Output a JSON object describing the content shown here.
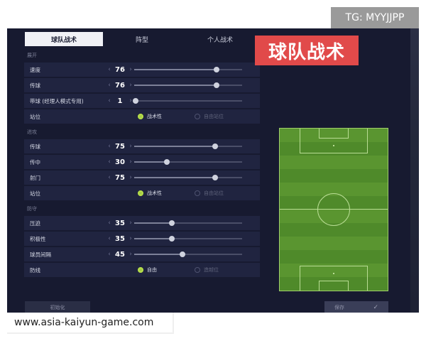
{
  "watermark": {
    "tg": "TG: MYYJJPP",
    "url": "www.asia-kaiyun-game.com"
  },
  "banner": "球队战术",
  "tabs": [
    {
      "label": "球队战术",
      "active": true
    },
    {
      "label": "阵型",
      "active": false
    },
    {
      "label": "个人战术",
      "active": false
    }
  ],
  "sections": {
    "build": {
      "title": "展开",
      "rows": [
        {
          "label": "速度",
          "value": "76",
          "level": 0.76
        },
        {
          "label": "传球",
          "value": "76",
          "level": 0.76
        },
        {
          "label": "带球 (经理人模式专用)",
          "value": "1",
          "level": 0.01
        }
      ],
      "position": {
        "label": "站位",
        "opt_on": "战术性",
        "opt_off": "自由站位"
      }
    },
    "attack": {
      "title": "进攻",
      "rows": [
        {
          "label": "传球",
          "value": "75",
          "level": 0.75
        },
        {
          "label": "传中",
          "value": "30",
          "level": 0.3
        },
        {
          "label": "射门",
          "value": "75",
          "level": 0.75
        }
      ],
      "position": {
        "label": "站位",
        "opt_on": "战术性",
        "opt_off": "自由站位"
      }
    },
    "defence": {
      "title": "防守",
      "rows": [
        {
          "label": "压迫",
          "value": "35",
          "level": 0.35
        },
        {
          "label": "积极性",
          "value": "35",
          "level": 0.35
        },
        {
          "label": "球员间隔",
          "value": "45",
          "level": 0.45
        }
      ],
      "line": {
        "label": "防线",
        "opt_on": "自由",
        "opt_off": "造越位"
      }
    }
  },
  "footer": {
    "reset": "初始化",
    "save": "保存",
    "check_icon": "✓"
  },
  "colors": {
    "bg": "#171a30",
    "row": "#202440",
    "accent": "#b7e04a",
    "banner": "#e14a4a",
    "pitch": "#4f8a2a"
  }
}
